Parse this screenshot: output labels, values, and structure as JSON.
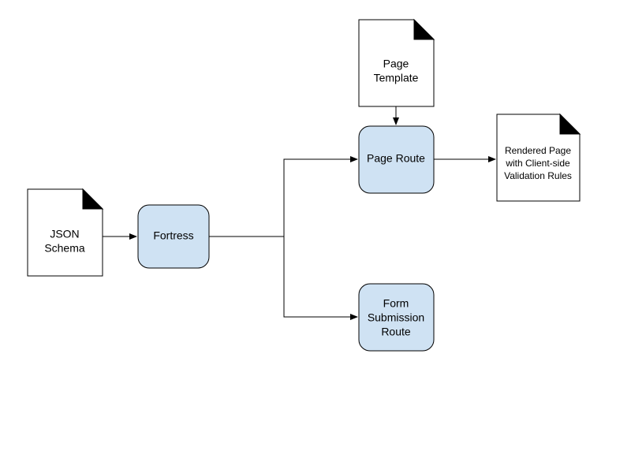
{
  "diagram": {
    "nodes": {
      "json_schema": {
        "line1": "JSON",
        "line2": "Schema"
      },
      "fortress": {
        "label": "Fortress"
      },
      "page_template": {
        "line1": "Page",
        "line2": "Template"
      },
      "page_route": {
        "label": "Page Route"
      },
      "form_submission_route": {
        "line1": "Form",
        "line2": "Submission",
        "line3": "Route"
      },
      "rendered_page": {
        "line1": "Rendered Page",
        "line2": "with Client-side",
        "line3": "Validation Rules"
      }
    }
  }
}
